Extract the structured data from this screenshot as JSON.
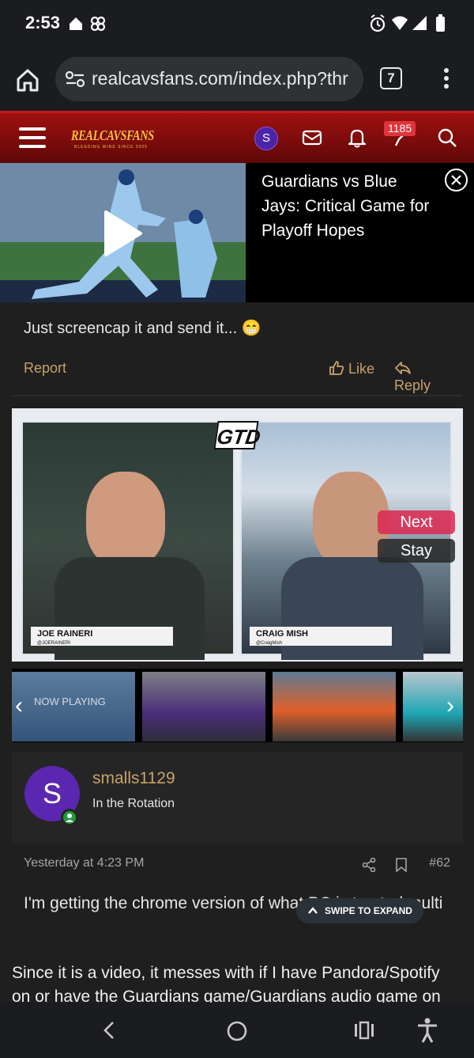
{
  "status_bar": {
    "time": "2:53",
    "icons": [
      "home-status-icon",
      "pinwheel-icon",
      "alarm-icon",
      "wifi-icon",
      "signal-icon",
      "battery-icon"
    ]
  },
  "browser": {
    "url": "realcavsfans.com/index.php?thr",
    "tab_count": "7"
  },
  "site_header": {
    "logo": "REALCAVSFANS",
    "logo_sub": "BLEEDING WINE SINCE 2005",
    "avatar_letter": "S",
    "notification_count": "1185"
  },
  "video_banner": {
    "title": "Guardians vs Blue Jays: Critical Game for Playoff Hopes"
  },
  "prev_post": {
    "text": "Just screencap it and send it... 😁",
    "report": "Report",
    "like": "Like",
    "reply": "Reply"
  },
  "video_player": {
    "logo": "GTD",
    "left_name": "JOE RAINERI",
    "left_handle": "@JOERAINERI",
    "right_name": "CRAIG MISH",
    "right_handle": "@CraigMish",
    "next": "Next",
    "stay": "Stay",
    "now_playing": "NOW PLAYING"
  },
  "post": {
    "avatar_letter": "S",
    "username": "smalls1129",
    "user_title": "In the Rotation",
    "timestamp": "Yesterday at 4:23 PM",
    "post_number": "#62",
    "body": "I'm getting the chrome version of what PC is trusted multi",
    "swipe_label": "SWIPE TO EXPAND"
  },
  "continued_text": "Since it is a video, it messes with if I have Pandora/Spotify on or have the Guardians game/Guardians audio game on",
  "colors": {
    "header_red": "#8b0e0e",
    "link_gold": "#c8a26a",
    "avatar_purple": "#5b26b0",
    "online_green": "#1e9b3a",
    "badge_red": "#e0343c"
  }
}
